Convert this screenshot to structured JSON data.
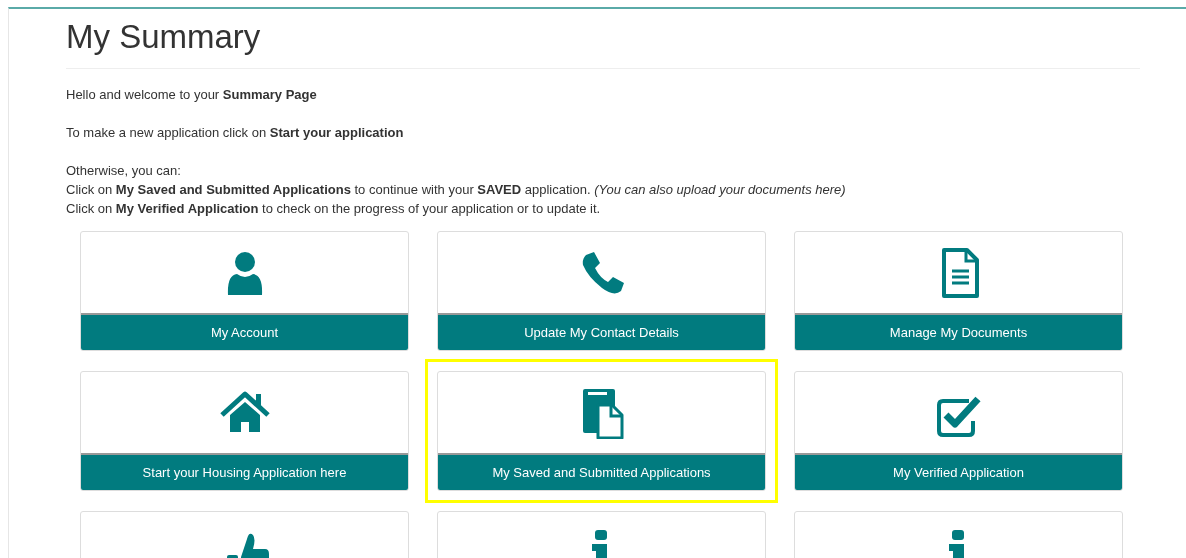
{
  "page": {
    "title": "My Summary"
  },
  "intro": [
    [
      "Hello and welcome to your **Summary Page**"
    ],
    [
      "To make a new application click on **Start your application**"
    ],
    [
      "Otherwise, you can:",
      "Click on **My Saved and Submitted Applications** to continue with your **SAVED** application. *(You can also upload your documents here)*",
      "Click on **My Verified Application** to check on the progress of your application or to update it."
    ]
  ],
  "tiles": [
    {
      "kind": "person",
      "label": "My Account",
      "highlighted": false
    },
    {
      "kind": "phone",
      "label": "Update My Contact Details",
      "highlighted": false
    },
    {
      "kind": "document",
      "label": "Manage My Documents",
      "highlighted": false
    },
    {
      "kind": "house",
      "label": "Start your Housing Application here",
      "highlighted": false
    },
    {
      "kind": "files",
      "label": "My Saved and Submitted Applications",
      "highlighted": true
    },
    {
      "kind": "check",
      "label": "My Verified Application",
      "highlighted": false
    },
    {
      "kind": "thumbs",
      "highlighted": false
    },
    {
      "kind": "info",
      "highlighted": false
    },
    {
      "kind": "info",
      "highlighted": false
    }
  ]
}
